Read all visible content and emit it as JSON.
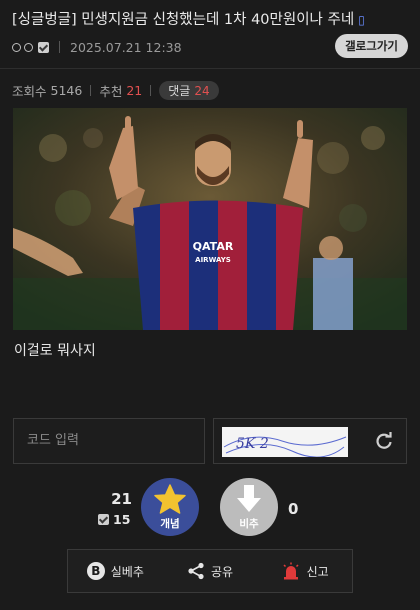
{
  "post": {
    "title": "[싱글벙글] 민생지원금 신청했는데 1차 40만원이나 주네",
    "datetime": "2025.07.21 12:38",
    "gallery_button": "갤로그가기",
    "caption": "이걸로 뭐사지"
  },
  "stats": {
    "views_label": "조회수",
    "views": "5146",
    "recommend_label": "추천",
    "recommend": "21",
    "comments_label": "댓글",
    "comments": "24"
  },
  "photo": {
    "banner_line1": "QATAR",
    "banner_line2": "AIRWAYS"
  },
  "captcha": {
    "input_placeholder": "코드 입력",
    "code_text": "5K 2"
  },
  "votes": {
    "up_count": "21",
    "fixed_count": "15",
    "up_label": "개념",
    "down_label": "비추",
    "down_count": "0"
  },
  "actions": {
    "silbe_letter": "B",
    "silbe_label": "실베추",
    "share_label": "공유",
    "report_label": "신고"
  },
  "colors": {
    "background": "#1b1b1b",
    "accent_red": "#e05050",
    "vote_up": "#3b4e9a",
    "vote_down": "#bcbcbc",
    "star": "#f2c230",
    "siren": "#e03a3a"
  }
}
